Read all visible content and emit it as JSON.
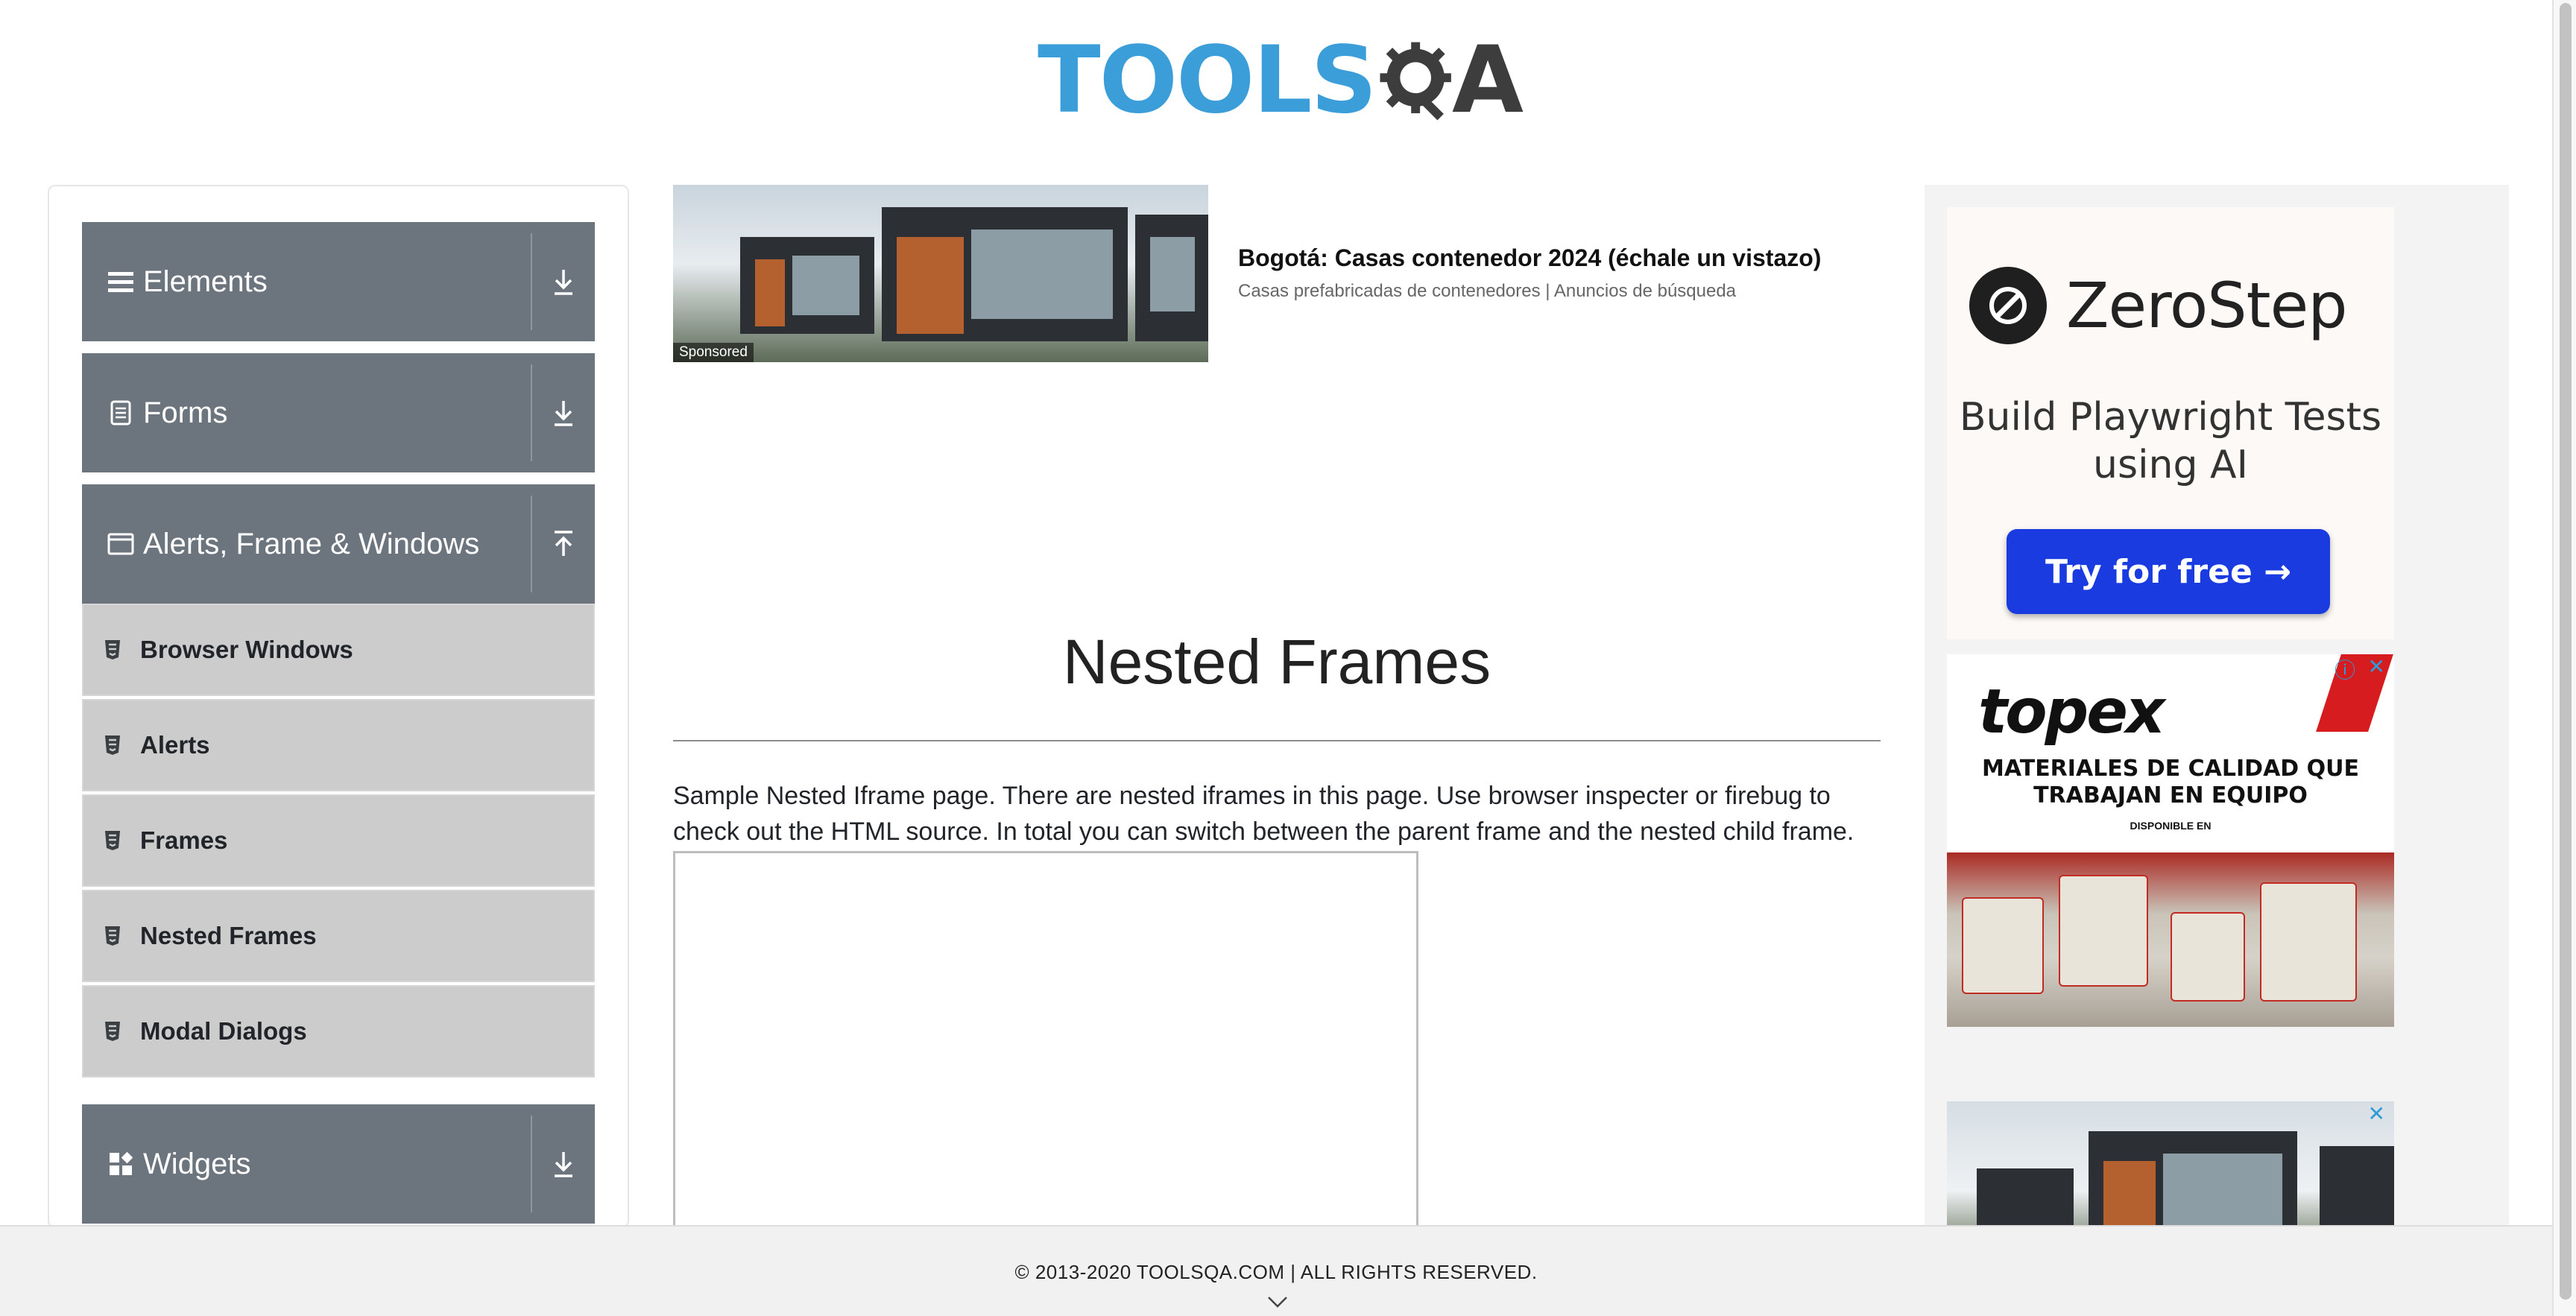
{
  "header": {
    "logo_tools": "TOOLS",
    "logo_qa": "QA"
  },
  "sidebar": {
    "groups": [
      {
        "label": "Elements",
        "icon": "hamburger-icon",
        "expanded": false
      },
      {
        "label": "Forms",
        "icon": "document-icon",
        "expanded": false
      },
      {
        "label": "Alerts, Frame & Windows",
        "icon": "window-icon",
        "expanded": true
      },
      {
        "label": "Widgets",
        "icon": "widgets-icon",
        "expanded": false
      }
    ],
    "sub_items": [
      {
        "label": "Browser Windows",
        "icon": "html5-icon"
      },
      {
        "label": "Alerts",
        "icon": "html5-icon"
      },
      {
        "label": "Frames",
        "icon": "html5-icon"
      },
      {
        "label": "Nested Frames",
        "icon": "html5-icon"
      },
      {
        "label": "Modal Dialogs",
        "icon": "html5-icon"
      }
    ]
  },
  "ad_top": {
    "badge": "Sponsored",
    "title": "Bogotá: Casas contenedor 2024 (échale un vistazo)",
    "subtitle": "Casas prefabricadas de contenedores | Anuncios de búsqueda"
  },
  "main": {
    "title": "Nested Frames",
    "description": "Sample Nested Iframe page. There are nested iframes in this page. Use browser inspecter or firebug to check out the HTML source. In total you can switch between the parent frame and the nested child frame."
  },
  "right_ads": {
    "zerostep": {
      "name": "ZeroStep",
      "tagline": "Build Playwright Tests using AI",
      "button": "Try for free →",
      "button_color": "#1a3be0"
    },
    "topex": {
      "logo": "topex",
      "headline": "MATERIALES DE CALIDAD QUE TRABAJAN EN EQUIPO",
      "disponible": "DISPONIBLE EN",
      "brand_color": "#d71c1f"
    }
  },
  "footer": {
    "text": "© 2013-2020 TOOLSQA.COM | ALL RIGHTS RESERVED."
  },
  "colors": {
    "group_header_bg": "#6c757d",
    "sub_item_bg": "#cccccc",
    "logo_blue": "#3c9ed8"
  }
}
